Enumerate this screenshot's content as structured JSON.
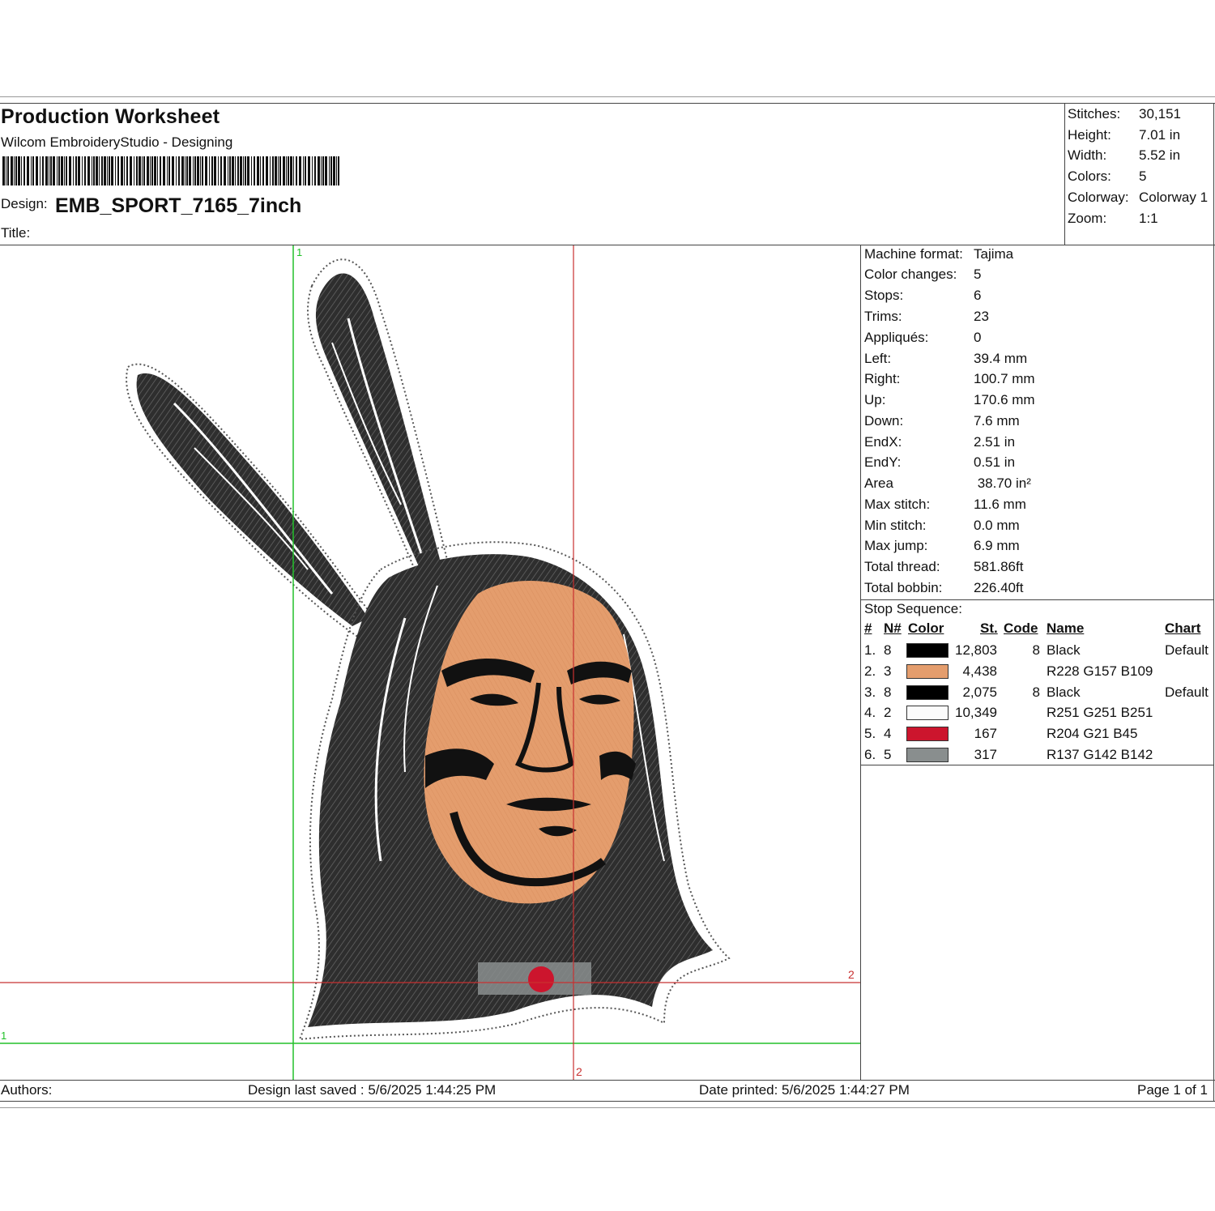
{
  "header": {
    "title": "Production Worksheet",
    "software": "Wilcom EmbroideryStudio - Designing",
    "design_label": "Design:",
    "design_name": "EMB_SPORT_7165_7inch",
    "title_label": "Title:"
  },
  "summary": [
    {
      "label": "Stitches:",
      "value": "30,151"
    },
    {
      "label": "Height:",
      "value": "7.01 in"
    },
    {
      "label": "Width:",
      "value": "5.52 in"
    },
    {
      "label": "Colors:",
      "value": "5"
    },
    {
      "label": "Colorway:",
      "value": "Colorway 1"
    },
    {
      "label": "Zoom:",
      "value": "1:1"
    }
  ],
  "machine_info": [
    {
      "label": "Machine format:",
      "value": "Tajima"
    },
    {
      "label": "Color changes:",
      "value": "5"
    },
    {
      "label": "Stops:",
      "value": "6"
    },
    {
      "label": "Trims:",
      "value": "23"
    },
    {
      "label": "Appliqués:",
      "value": "0"
    },
    {
      "label": "Left:",
      "value": "39.4 mm"
    },
    {
      "label": "Right:",
      "value": "100.7 mm"
    },
    {
      "label": "Up:",
      "value": "170.6 mm"
    },
    {
      "label": "Down:",
      "value": "7.6 mm"
    },
    {
      "label": "EndX:",
      "value": "2.51 in"
    },
    {
      "label": "EndY:",
      "value": "0.51 in"
    },
    {
      "label": "Area",
      "value": " 38.70 in²"
    },
    {
      "label": "Max stitch:",
      "value": "11.6 mm"
    },
    {
      "label": "Min stitch:",
      "value": "0.0 mm"
    },
    {
      "label": "Max jump:",
      "value": "6.9 mm"
    },
    {
      "label": "Total thread:",
      "value": "581.86ft"
    },
    {
      "label": "Total bobbin:",
      "value": "226.40ft"
    }
  ],
  "stop_sequence": {
    "title": "Stop Sequence:",
    "headers": {
      "num": "#",
      "needle": "N#",
      "color": "Color",
      "stitches": "St.",
      "code": "Code",
      "name": "Name",
      "chart": "Chart"
    },
    "rows": [
      {
        "num": "1.",
        "needle": "8",
        "color": "#000000",
        "stitches": "12,803",
        "code": "8",
        "name": "Black",
        "chart": "Default"
      },
      {
        "num": "2.",
        "needle": "3",
        "color": "#E49D6D",
        "stitches": "4,438",
        "code": "",
        "name": "R228 G157 B109",
        "chart": ""
      },
      {
        "num": "3.",
        "needle": "8",
        "color": "#000000",
        "stitches": "2,075",
        "code": "8",
        "name": "Black",
        "chart": "Default"
      },
      {
        "num": "4.",
        "needle": "2",
        "color": "#FBFBFB",
        "stitches": "10,349",
        "code": "",
        "name": "R251 G251 B251",
        "chart": ""
      },
      {
        "num": "5.",
        "needle": "4",
        "color": "#CC152D",
        "stitches": "167",
        "code": "",
        "name": "R204 G21 B45",
        "chart": ""
      },
      {
        "num": "6.",
        "needle": "5",
        "color": "#898E8E",
        "stitches": "317",
        "code": "",
        "name": "R137 G142 B142",
        "chart": ""
      }
    ]
  },
  "guides": {
    "green_label": "1",
    "red_label": "2"
  },
  "footer": {
    "authors": "Authors:",
    "last_saved": "Design last saved : 5/6/2025 1:44:25 PM",
    "printed": "Date printed: 5/6/2025 1:44:27 PM",
    "page": "Page 1 of 1"
  },
  "colors": {
    "skin": "#E49D6D",
    "hair": "#3a3a3a",
    "guide_green": "#22c02a",
    "guide_red": "#c83030"
  }
}
